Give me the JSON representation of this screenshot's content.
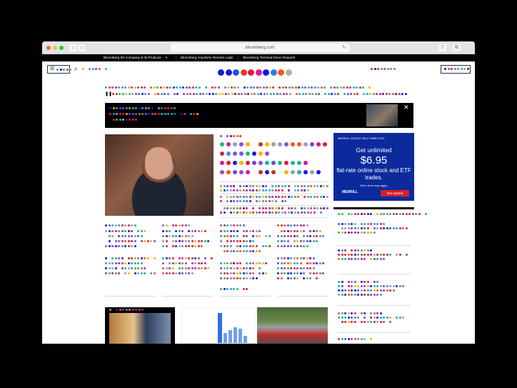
{
  "browser": {
    "url": "bloomberg.com",
    "back_icon": "‹",
    "forward_icon": "›",
    "reload_icon": "↻",
    "share_icon": "⇧",
    "tabs_icon": "⧉"
  },
  "topbar": {
    "links": [
      "Bloomberg the Company & Its Products",
      "Bloomberg Anywhere Remote Login",
      "Bloomberg Terminal Demo Request"
    ],
    "dropdown_glyph": "▾",
    "separator": "|"
  },
  "header": {
    "menu_glyph": "☰",
    "search_glyph": "⌕",
    "logo_colors": [
      "#1a1ad6",
      "#1a1ad6",
      "#2255cc",
      "#e23a2a",
      "#e8183c",
      "#d61a9a",
      "#1a1ad6",
      "#2f7de0",
      "#f25a1a",
      "#b8b0a0"
    ]
  },
  "ticker": {
    "pause_glyph": "❚❚"
  },
  "banner": {
    "close_glyph": "✕"
  },
  "ad": {
    "brand": "MERRILL EDGE® SELF-DIRECTED",
    "headline": "Get unlimited",
    "price": "$6.95",
    "body": "flat-rate online stock and ETF trades.",
    "fine_print": "Other fees may apply.",
    "merrill": "MERRILL",
    "cta": "Get started"
  },
  "colors": {
    "palette": [
      "#e8183c",
      "#1a1ad6",
      "#2bb673",
      "#f7b500",
      "#8a4fd6",
      "#2f9ce0",
      "#f25a1a",
      "#1ab5a8",
      "#d61a9a",
      "#9aa0a6",
      "#6b4ad6",
      "#c03030"
    ],
    "accent_blue": "#0b2a9c",
    "cta_red": "#d3202b"
  }
}
